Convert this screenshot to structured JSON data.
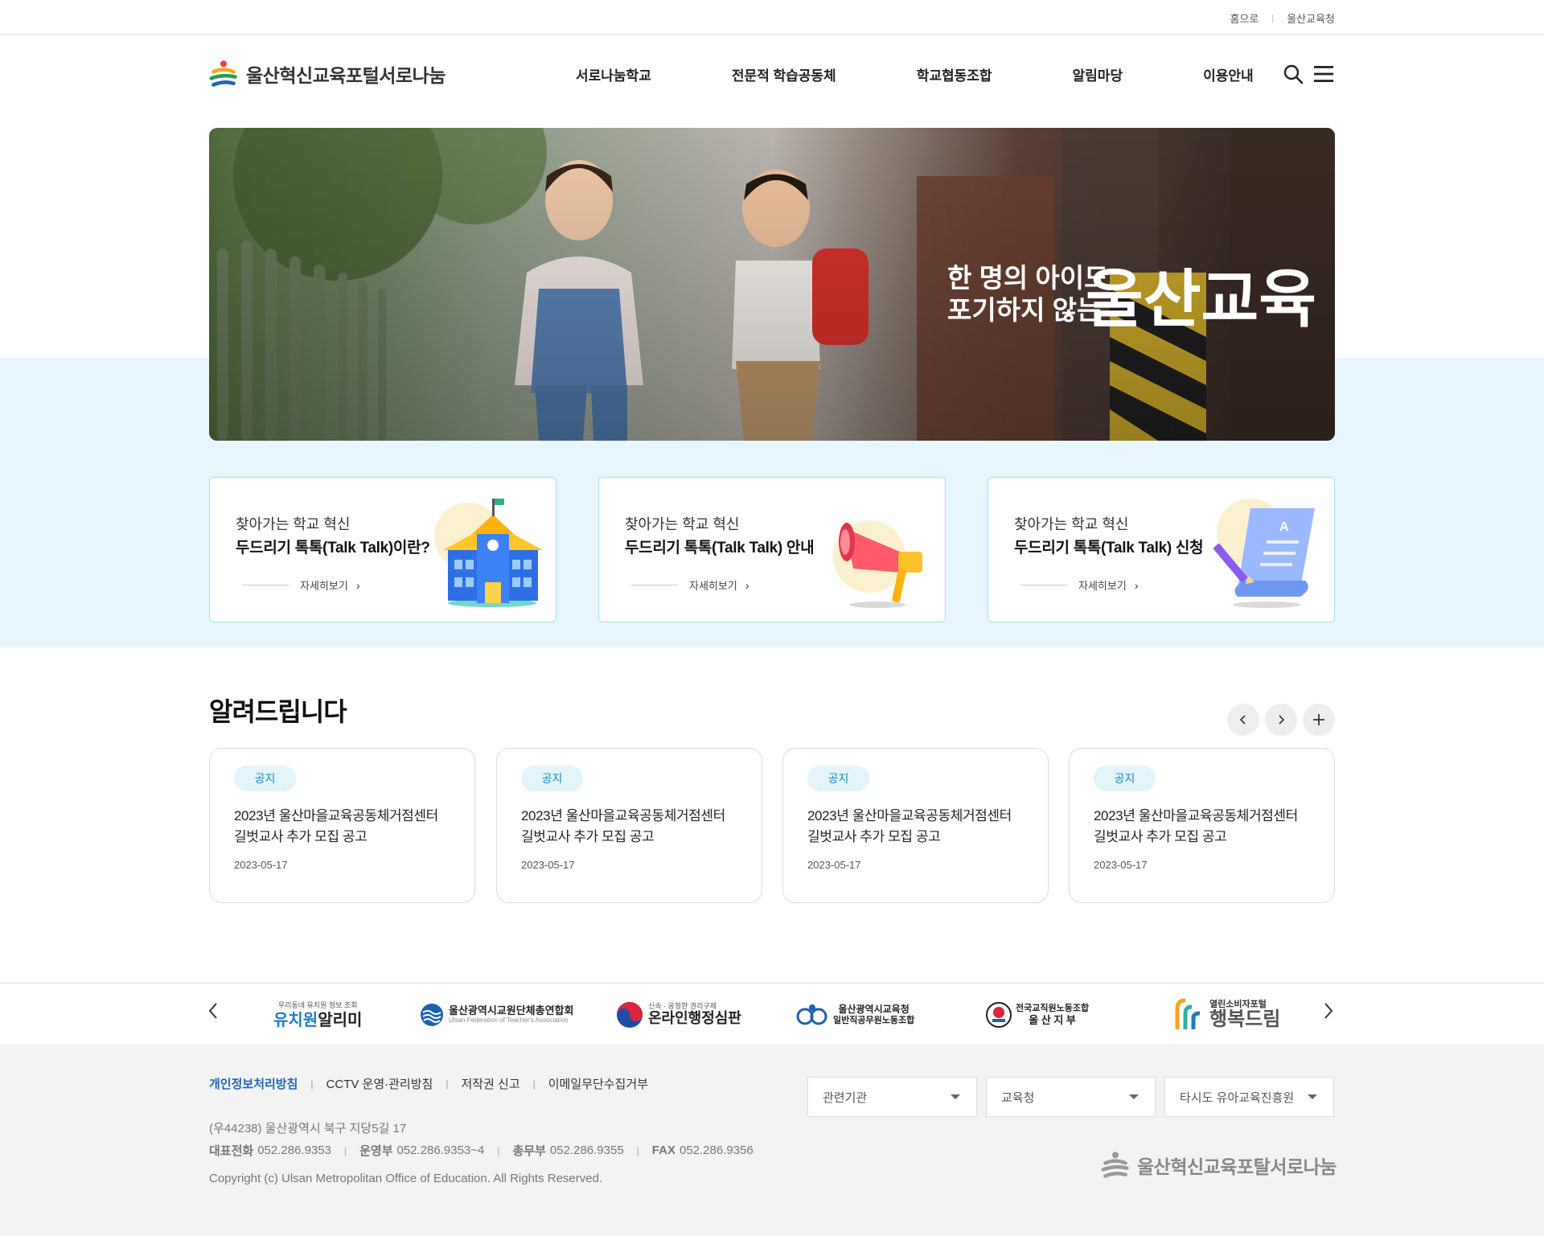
{
  "topbar": {
    "home": "홈으로",
    "office": "울산교육청"
  },
  "header": {
    "logo_text": "울산혁신교육포털서로나눔",
    "menu": [
      "서로나눔학교",
      "전문적 학습공동체",
      "학교협동조합",
      "알림마당",
      "이용안내"
    ]
  },
  "hero": {
    "slogan_line1": "한 명의 아이도",
    "slogan_line2": "포기하지 않는",
    "slogan_big": "울산교육"
  },
  "cards": [
    {
      "sub": "찾아가는 학교 혁신",
      "title": "두드리기 톡톡(Talk Talk)이란?",
      "more": "자세히보기"
    },
    {
      "sub": "찾아가는 학교 혁신",
      "title": "두드리기 톡톡(Talk Talk) 안내",
      "more": "자세히보기"
    },
    {
      "sub": "찾아가는 학교 혁신",
      "title": "두드리기 톡톡(Talk Talk) 신청",
      "more": "자세히보기"
    }
  ],
  "notice": {
    "title": "알려드립니다",
    "items": [
      {
        "badge": "공지",
        "line1": "2023년 울산마을교육공동체거점센터",
        "line2": "길벗교사 추가 모집 공고",
        "date": "2023-05-17"
      },
      {
        "badge": "공지",
        "line1": "2023년 울산마을교육공동체거점센터",
        "line2": "길벗교사 추가 모집 공고",
        "date": "2023-05-17"
      },
      {
        "badge": "공지",
        "line1": "2023년 울산마을교육공동체거점센터",
        "line2": "길벗교사 추가 모집 공고",
        "date": "2023-05-17"
      },
      {
        "badge": "공지",
        "line1": "2023년 울산마을교육공동체거점센터",
        "line2": "길벗교사 추가 모집 공고",
        "date": "2023-05-17"
      }
    ]
  },
  "partners": [
    {
      "small": "우리동네 유치원 정보 조회",
      "main_a": "유치원",
      "main_b": "알리미"
    },
    {
      "main": "울산광역시교원단체총연합회",
      "small": "Ulsan Federation of Teacher's Association"
    },
    {
      "small": "신속 · 공정한 권리구제",
      "main": "온라인행정심판"
    },
    {
      "main": "울산광역시교육청",
      "small": "일반직공무원노동조합"
    },
    {
      "main": "전국교직원노동조합",
      "small": "울 산 지 부"
    },
    {
      "small": "열린소비자포털",
      "main": "행복드림"
    }
  ],
  "footer": {
    "links": [
      "개인정보처리방침",
      "CCTV 운영·관리방침",
      "저작권 신고",
      "이메일무단수집거부"
    ],
    "address": "(우44238) 울산광역시 북구 지당5길 17",
    "phones": [
      {
        "k": "대표전화",
        "v": "052.286.9353"
      },
      {
        "k": "운영부",
        "v": "052.286.9353~4"
      },
      {
        "k": "총무부",
        "v": "052.286.9355"
      },
      {
        "k": "FAX",
        "v": "052.286.9356"
      }
    ],
    "copyright": "Copyright (c) Ulsan Metropolitan Office of Education. All Rights Reserved.",
    "selects": [
      "관련기관",
      "교육청",
      "타시도 유아교육진흥원"
    ],
    "logo_text": "울산혁신교육포탈서로나눔"
  },
  "colors": {
    "accent": "#1e66b3",
    "band": "#e7f6fc",
    "card_border": "#a9dff0",
    "badge_bg": "#e3f4fb"
  }
}
